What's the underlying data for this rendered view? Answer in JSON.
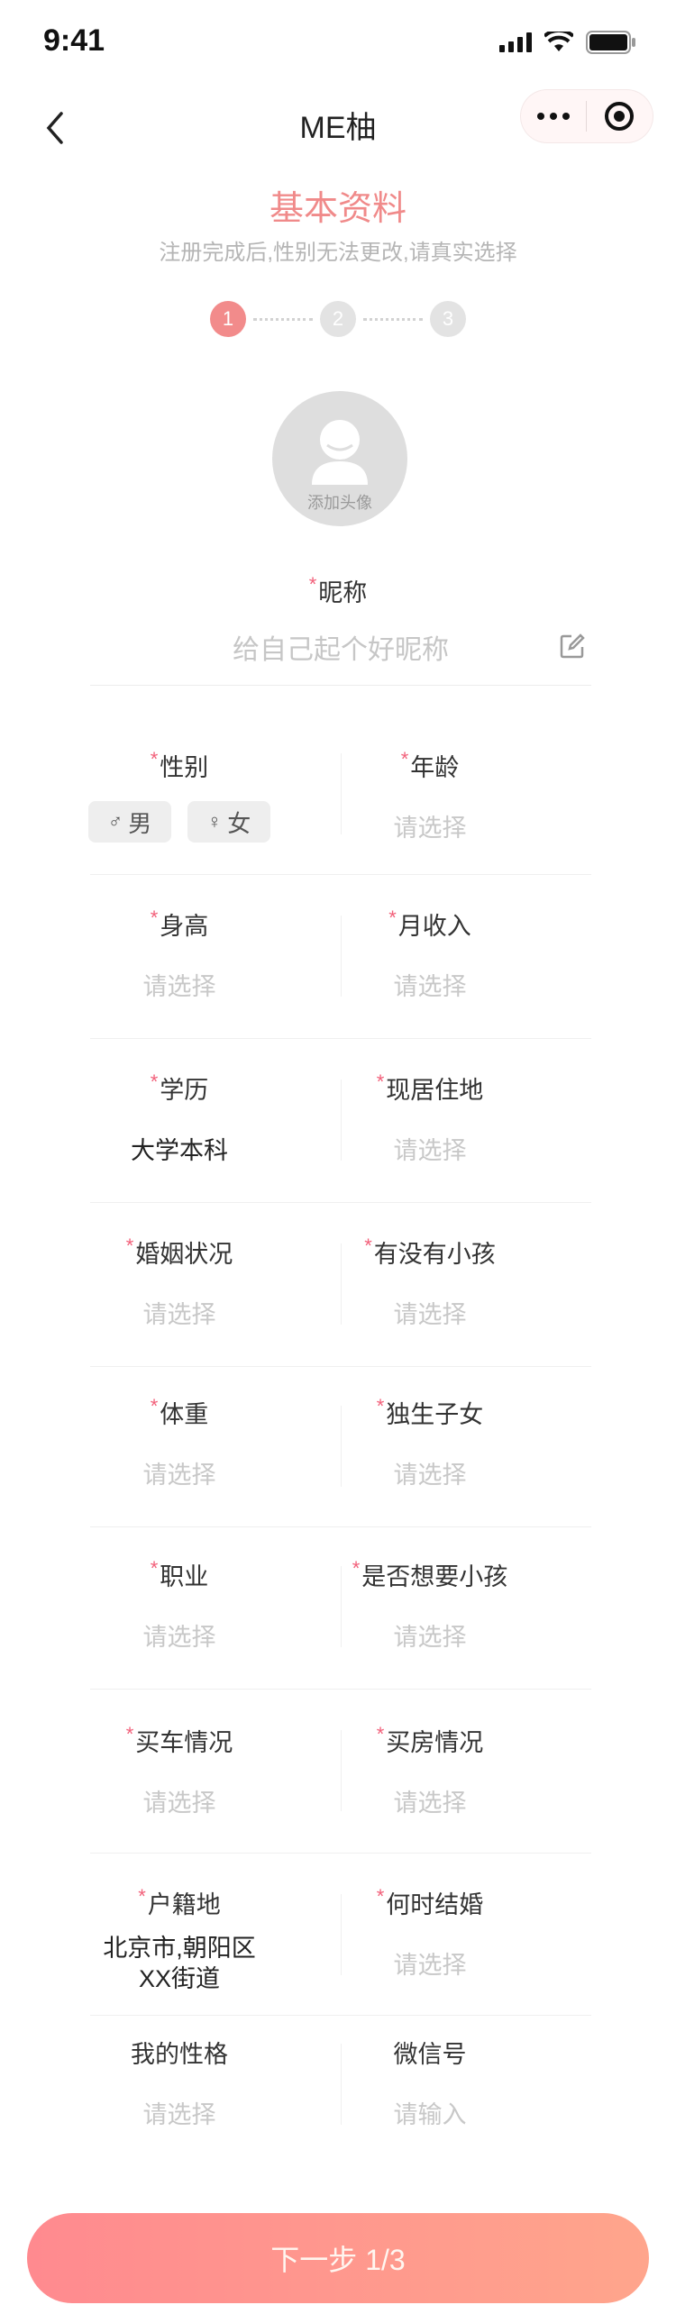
{
  "status_bar": {
    "time": "9:41"
  },
  "nav": {
    "title": "ME柚"
  },
  "header": {
    "title": "基本资料",
    "subtitle": "注册完成后,性别无法更改,请真实选择"
  },
  "steps": [
    "1",
    "2",
    "3"
  ],
  "avatar": {
    "label": "添加头像"
  },
  "nickname": {
    "label": "昵称",
    "placeholder": "给自己起个好昵称"
  },
  "required_mark": "*",
  "gender": {
    "label": "性别",
    "male": "男",
    "female": "女"
  },
  "rows": [
    {
      "left": {
        "label": "性别"
      },
      "right": {
        "label": "年龄",
        "value": "请选择"
      }
    },
    {
      "left": {
        "label": "身高",
        "value": "请选择"
      },
      "right": {
        "label": "月收入",
        "value": "请选择"
      }
    },
    {
      "left": {
        "label": "学历",
        "value": "大学本科"
      },
      "right": {
        "label": "现居住地",
        "value": "请选择"
      }
    },
    {
      "left": {
        "label": "婚姻状况",
        "value": "请选择"
      },
      "right": {
        "label": "有没有小孩",
        "value": "请选择"
      }
    },
    {
      "left": {
        "label": "体重",
        "value": "请选择"
      },
      "right": {
        "label": "独生子女",
        "value": "请选择"
      }
    },
    {
      "left": {
        "label": "职业",
        "value": "请选择"
      },
      "right": {
        "label": "是否想要小孩",
        "value": "请选择"
      }
    },
    {
      "left": {
        "label": "买车情况",
        "value": "请选择"
      },
      "right": {
        "label": "买房情况",
        "value": "请选择"
      }
    },
    {
      "left": {
        "label": "户籍地",
        "value_line1": "北京市,朝阳区",
        "value_line2": "XX街道"
      },
      "right": {
        "label": "何时结婚",
        "value": "请选择"
      }
    },
    {
      "left": {
        "label": "我的性格",
        "value": "请选择"
      },
      "right": {
        "label": "微信号",
        "value": "请输入"
      }
    }
  ],
  "next_button": {
    "label": "下一步 1/3"
  },
  "colors": {
    "accent": "#f28b8b",
    "button_start": "#ff8a8f",
    "button_end": "#ffa58c"
  }
}
